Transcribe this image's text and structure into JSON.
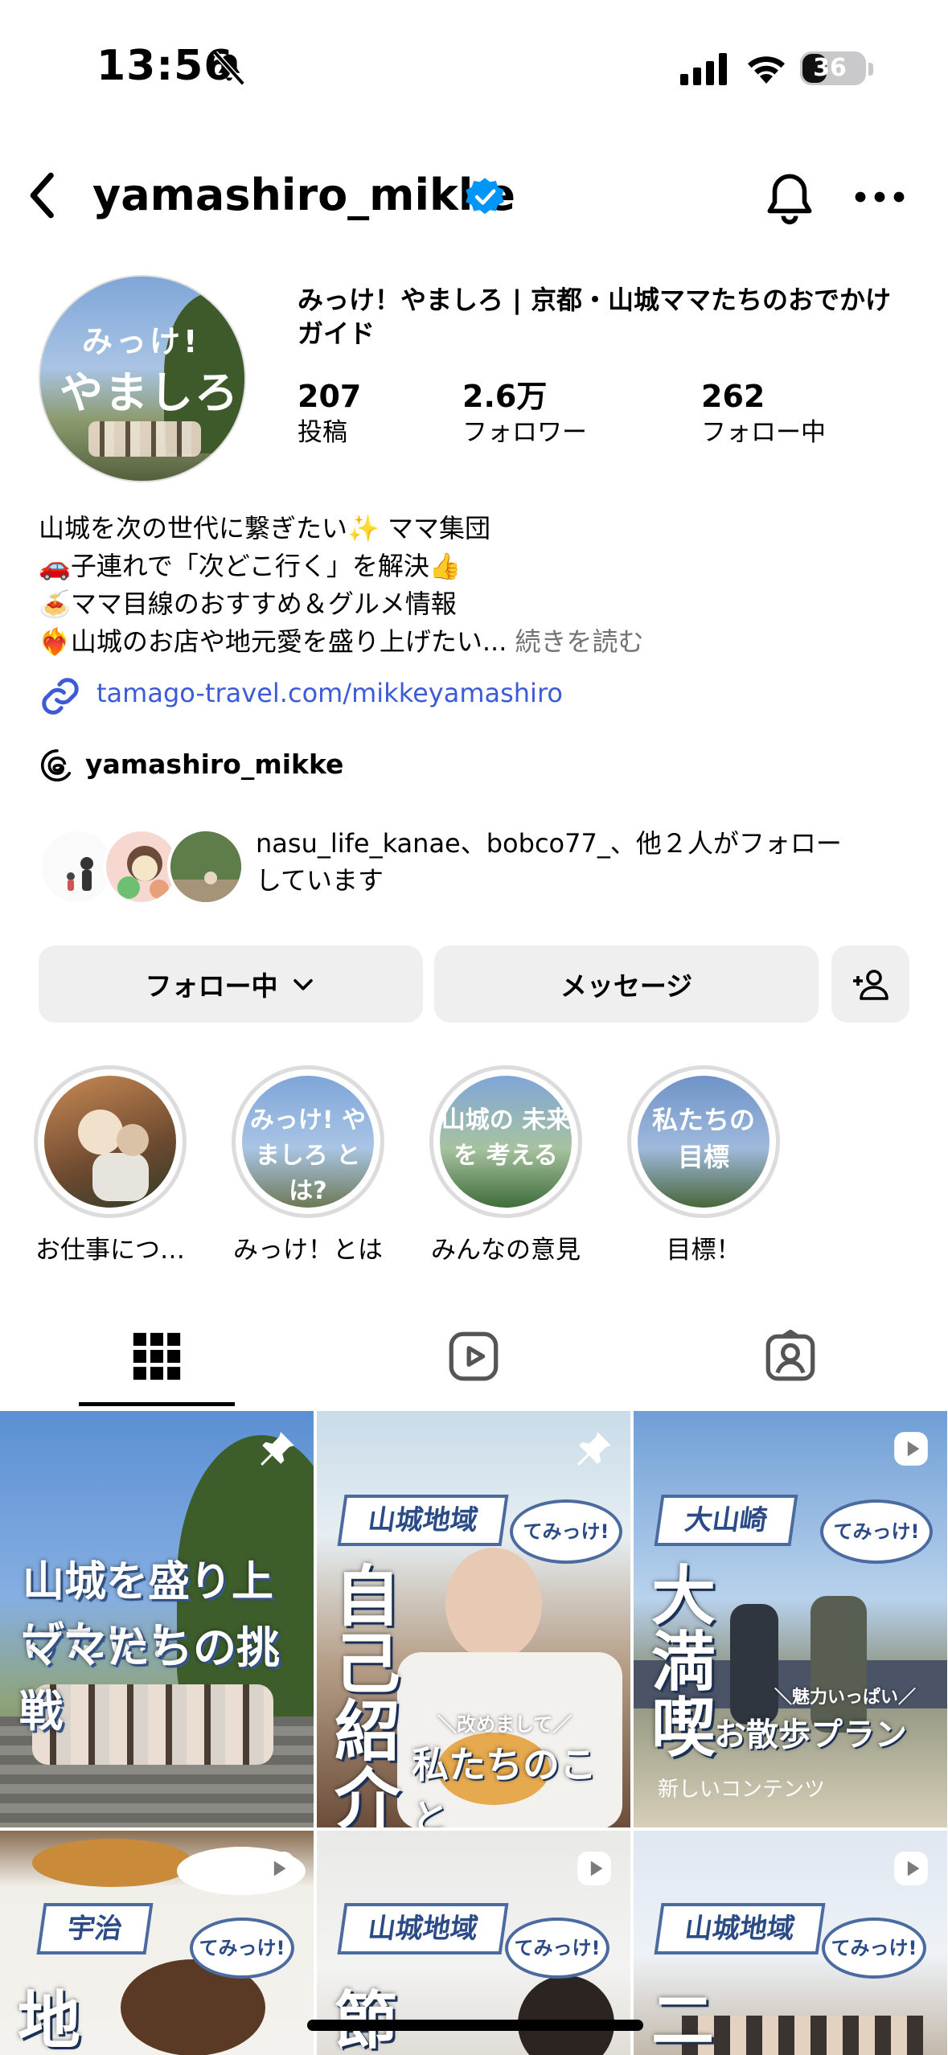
{
  "status_bar": {
    "time": "13:56",
    "battery": "36"
  },
  "header": {
    "username": "yamashiro_mikke"
  },
  "profile": {
    "full_name": "みっけ！やましろ | 京都・山城ママたちのおでかけガイド",
    "avatar_text_line1": "みっけ!",
    "avatar_text_line2": "やましろ",
    "stats": [
      {
        "value": "207",
        "label": "投稿"
      },
      {
        "value": "2.6万",
        "label": "フォロワー"
      },
      {
        "value": "262",
        "label": "フォロー中"
      }
    ],
    "bio_lines": [
      "山城を次の世代に繋ぎたい✨ ママ集団",
      "🚗子連れで「次どこ行く」を解決👍",
      "🍝ママ目線のおすすめ＆グルメ情報",
      "❤️‍🔥山城のお店や地元愛を盛り上げたい..."
    ],
    "bio_more": "続きを読む",
    "link": "tamago-travel.com/mikkeyamashiro",
    "threads_handle": "yamashiro_mikke",
    "followed_by_line1": "nasu_life_kanae、bobco77_、他２人がフォロー",
    "followed_by_line2": "しています"
  },
  "actions": {
    "following": "フォロー中",
    "message": "メッセージ"
  },
  "highlights": [
    {
      "label": "お仕事につ…",
      "image_text": ""
    },
    {
      "label": "みっけ！とは",
      "image_text": "みっけ! やましろ とは?"
    },
    {
      "label": "みんなの意見",
      "image_text": "山城の 未来を 考える"
    },
    {
      "label": "目標！",
      "image_text": "私たちの 目標"
    }
  ],
  "tabs": [
    "grid-icon",
    "reels-icon",
    "tagged-icon"
  ],
  "posts": [
    {
      "tag": "",
      "title1": "山城を盛り上げたい！",
      "title2": "ママたちの挑戦",
      "badge": "pin-icon"
    },
    {
      "tag": "山城地域",
      "bubble": "てみっけ!",
      "vertical": "自己紹介",
      "sub_small": "＼改めまして／",
      "sub": "私たちのこと",
      "badge": "pin-icon"
    },
    {
      "tag": "大山崎",
      "bubble": "てみっけ!",
      "vertical": "大満喫",
      "sub_small": "＼魅力いっぱい／",
      "sub": "お散歩プラン",
      "note": "新しいコンテンツ",
      "badge": "reel-icon"
    },
    {
      "tag": "宇治",
      "bubble": "てみっけ!",
      "vertical": "地",
      "badge": "reel-icon"
    },
    {
      "tag": "山城地域",
      "bubble": "てみっけ!",
      "vertical": "節",
      "badge": "reel-icon"
    },
    {
      "tag": "山城地域",
      "bubble": "てみっけ!",
      "vertical": "二",
      "badge": "reel-icon"
    }
  ],
  "colors": {
    "link": "#3d5bd9",
    "verified": "#0095f6",
    "button_bg": "#efefef",
    "muted": "#737373"
  }
}
